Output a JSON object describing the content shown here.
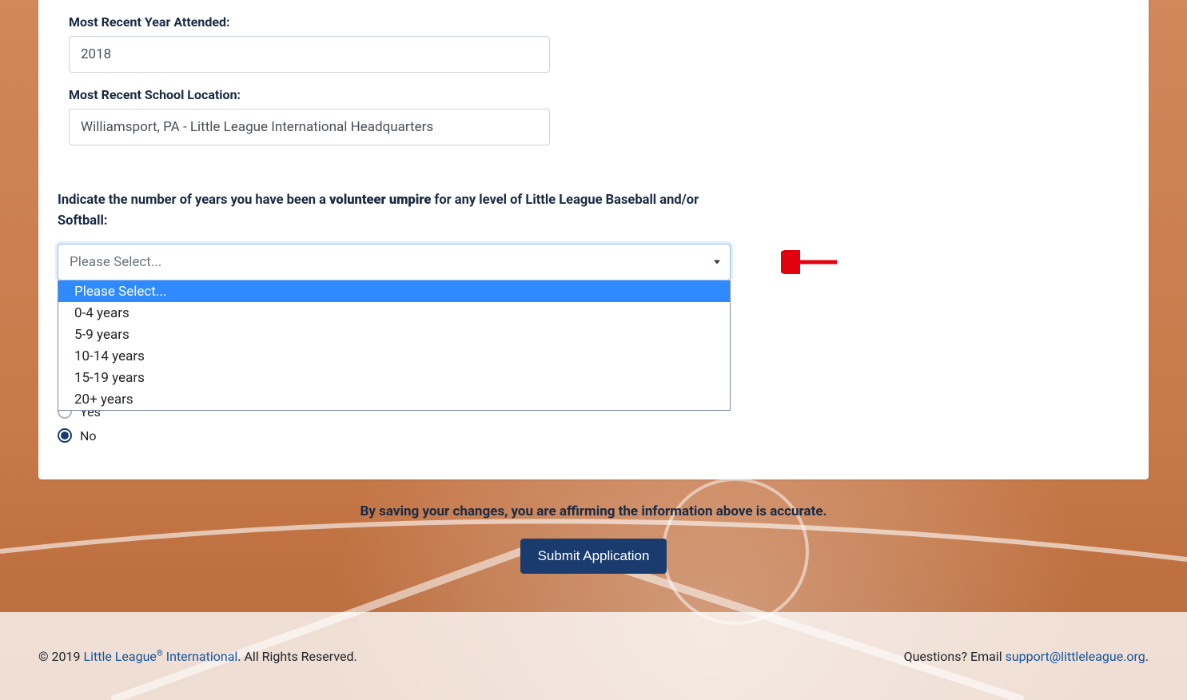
{
  "form": {
    "year_label": "Most Recent Year Attended:",
    "year_value": "2018",
    "location_label": "Most Recent School Location:",
    "location_value": "Williamsport, PA - Little League International Headquarters",
    "years_volunteer_prefix": "Indicate the number of years you have been a ",
    "years_volunteer_bold": "volunteer umpire",
    "years_volunteer_suffix": " for any level of Little League Baseball and/or Softball:",
    "select_placeholder": "Please Select...",
    "options": [
      "Please Select...",
      "0-4 years",
      "5-9 years",
      "10-14 years",
      "15-19 years",
      "20+ years"
    ],
    "highlighted_option_index": 0,
    "radio_yes": "Yes",
    "radio_no": "No",
    "radio_selected": "no"
  },
  "affirm": "By saving your changes, you are affirming the information above is accurate.",
  "submit_label": "Submit Application",
  "footer": {
    "copyright_prefix": "© 2019 ",
    "org_link": "Little League",
    "org_sup": "®",
    "org_suffix": " International",
    "rights": ". All Rights Reserved.",
    "questions": "Questions? Email ",
    "email": "support@littleleague.org",
    "period": "."
  },
  "colors": {
    "accent": "#1a3b6e",
    "highlight": "#2f8aff"
  }
}
